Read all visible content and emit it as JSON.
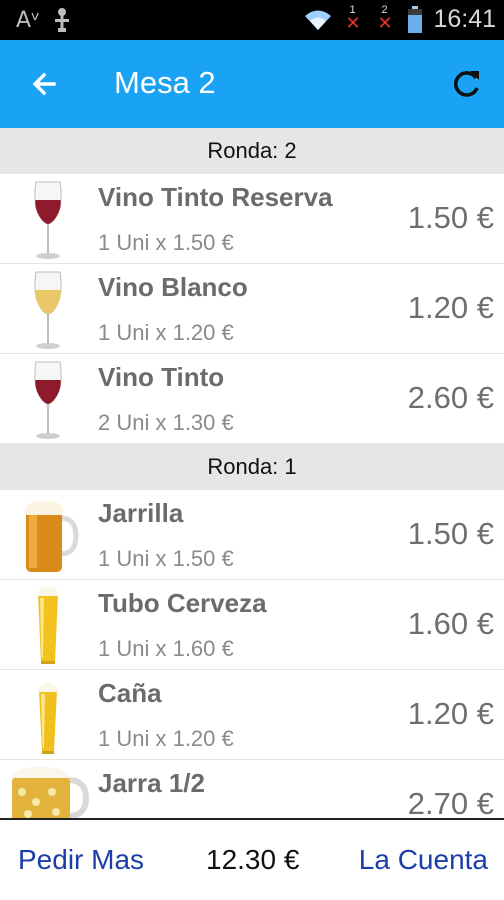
{
  "status_bar": {
    "left_glyph": "Aᵛ",
    "sim1_label": "1",
    "sim2_label": "2",
    "time": "16:41",
    "icons": [
      "font-size-icon",
      "usb-debug-icon",
      "wifi-icon",
      "sim1-no-signal-icon",
      "sim2-no-signal-icon",
      "battery-icon"
    ]
  },
  "app_bar": {
    "title": "Mesa 2",
    "color": "#1aa3f5",
    "back_icon": "arrow-left-icon",
    "refresh_icon": "refresh-icon"
  },
  "rounds": [
    {
      "label": "Ronda: 2",
      "items": [
        {
          "name": "Vino Tinto Reserva",
          "qty": "1 Uni x 1.50 €",
          "price": "1.50 €",
          "icon": "red-wine-glass-icon"
        },
        {
          "name": "Vino Blanco",
          "qty": "1 Uni x 1.20 €",
          "price": "1.20 €",
          "icon": "white-wine-glass-icon"
        },
        {
          "name": "Vino Tinto",
          "qty": "2 Uni x 1.30 €",
          "price": "2.60 €",
          "icon": "red-wine-glass-icon"
        }
      ]
    },
    {
      "label": "Ronda: 1",
      "items": [
        {
          "name": "Jarrilla",
          "qty": "1 Uni x 1.50 €",
          "price": "1.50 €",
          "icon": "beer-mug-icon"
        },
        {
          "name": "Tubo Cerveza",
          "qty": "1 Uni x 1.60 €",
          "price": "1.60 €",
          "icon": "beer-tall-glass-icon"
        },
        {
          "name": "Caña",
          "qty": "1 Uni x 1.20 €",
          "price": "1.20 €",
          "icon": "beer-small-glass-icon"
        },
        {
          "name": "Jarra 1/2",
          "qty": "",
          "price": "2.70 €",
          "icon": "beer-stein-icon"
        }
      ]
    }
  ],
  "bottom_bar": {
    "pedir_label": "Pedir Mas",
    "total": "12.30 €",
    "cuenta_label": "La Cuenta",
    "link_color": "#1c3ea8"
  }
}
